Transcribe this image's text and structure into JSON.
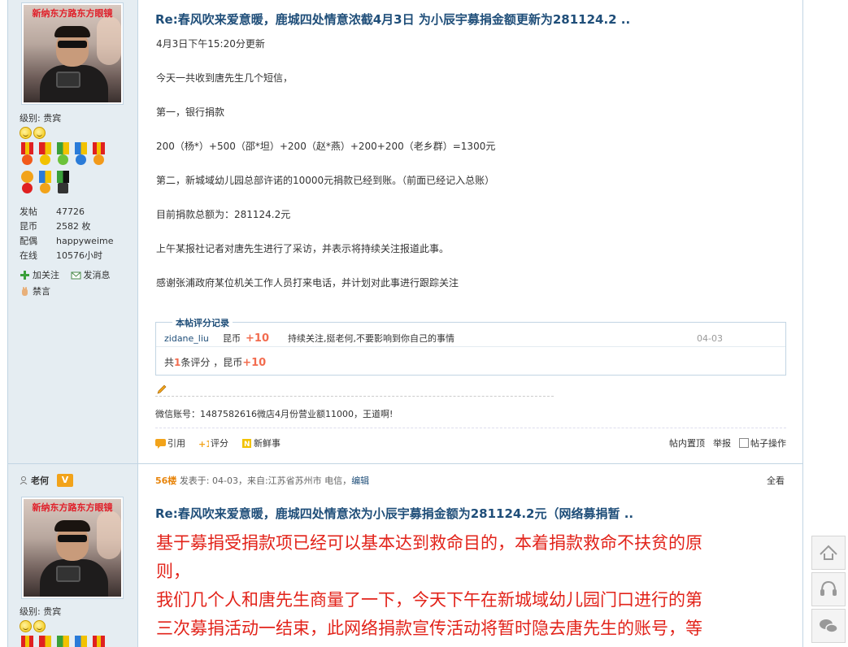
{
  "post1": {
    "user": {
      "avatar_ad_text": "新纳东方路东方眼镜",
      "level_label": "级别: 贵宾",
      "stats": [
        {
          "key": "发帖",
          "value": "47726"
        },
        {
          "key": "昆币",
          "value": "2582 枚"
        },
        {
          "key": "配偶",
          "value": "happyweime"
        },
        {
          "key": "在线",
          "value": "10576小时"
        }
      ],
      "actions": {
        "follow": "加关注",
        "message": "发消息",
        "ban": "禁言"
      }
    },
    "title": "Re:春风吹来爱意暖，鹿城四处情意浓截4月3日 为小辰宇募捐金额更新为281124.2 ..",
    "body": [
      "4月3日下午15:20分更新",
      "今天一共收到唐先生几个短信，",
      "第一，银行捐款",
      "200（杨*）+500（邵*坦）+200（赵*燕）+200+200（老乡群）=1300元",
      "第二，新城域幼儿园总部许诺的10000元捐款已经到账。（前面已经记入总账）",
      "目前捐款总额为：281124.2元",
      "上午某报社记者对唐先生进行了采访，并表示将持续关注报道此事。",
      "感谢张浦政府某位机关工作人员打来电话，并计划对此事进行跟踪关注"
    ],
    "rating": {
      "legend": "本帖评分记录",
      "rows": [
        {
          "user": "zidane_liu",
          "currency": "昆币",
          "amount": "+10",
          "reason": "持续关注,挺老何,不要影响到你自己的事情",
          "date": "04-03"
        }
      ],
      "summary_prefix": "共",
      "summary_count": "1",
      "summary_mid": "条评分 ，昆币",
      "summary_amount": "+10"
    },
    "signature": "微信账号：1487582616微店4月份营业额11000，王道啊!",
    "footer": {
      "quote": "引用",
      "rate": "评分",
      "fresh": "新鲜事",
      "pin": "帖内置顶",
      "report": "举报",
      "ops": "帖子操作"
    }
  },
  "post2": {
    "user": {
      "name": "老何",
      "vip": "V",
      "avatar_ad_text": "新纳东方路东方眼镜",
      "level_label": "级别: 贵宾"
    },
    "floor": "56楼",
    "meta_prefix": "发表于: 04-03，来自:江苏省苏州市 电信，",
    "edit_link": "编辑",
    "view_all": "全看",
    "title": "Re:春风吹来爱意暖，鹿城四处情意浓为小辰宇募捐金额为281124.2元（网络募捐暂 ..",
    "big_text": [
      "基于募捐受捐款项已经可以基本达到救命目的，本着捐款救命不扶贫的原",
      "则，",
      "我们几个人和唐先生商量了一下，今天下午在新城域幼儿园门口进行的第",
      "三次募捐活动一结束，此网络捐款宣传活动将暂时隐去唐先生的账号，等"
    ]
  },
  "colors": {
    "title_blue": "#1f4e79",
    "side_bg": "#e5edf2",
    "border": "#c2d5e3",
    "accent_red": "#e2231a",
    "rate_red": "#f26c4f",
    "floor_orange": "#e8850c"
  },
  "tools": [
    "arrow-up-icon",
    "headset-icon",
    "wechat-icon"
  ]
}
